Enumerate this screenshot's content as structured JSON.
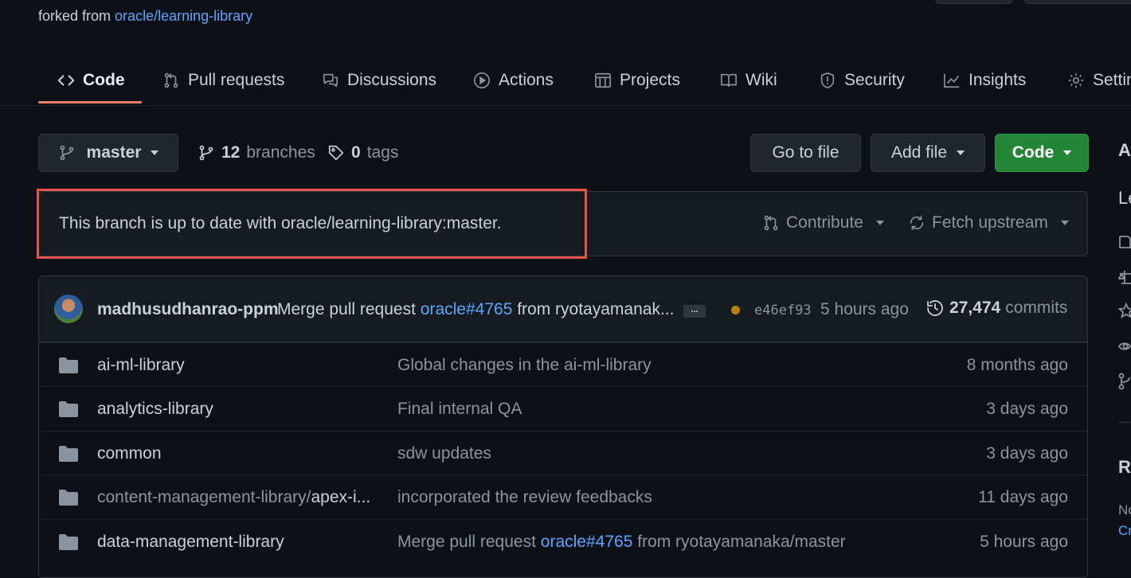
{
  "header": {
    "forked_prefix": "forked from",
    "forked_link": "oracle/learning-library"
  },
  "tabs": [
    {
      "label": "Code",
      "icon": "code-icon",
      "active": true
    },
    {
      "label": "Pull requests",
      "icon": "pull-request-icon"
    },
    {
      "label": "Discussions",
      "icon": "discussions-icon"
    },
    {
      "label": "Actions",
      "icon": "actions-icon"
    },
    {
      "label": "Projects",
      "icon": "projects-icon"
    },
    {
      "label": "Wiki",
      "icon": "book-icon"
    },
    {
      "label": "Security",
      "icon": "shield-icon"
    },
    {
      "label": "Insights",
      "icon": "graph-icon"
    },
    {
      "label": "Settin",
      "icon": "gear-icon"
    }
  ],
  "branch": {
    "name": "master",
    "branches_count": "12",
    "branches_label": "branches",
    "tags_count": "0",
    "tags_label": "tags",
    "go_to_file": "Go to file",
    "add_file": "Add file",
    "code": "Code"
  },
  "status": {
    "message": "This branch is up to date with oracle/learning-library:master.",
    "contribute": "Contribute",
    "fetch_upstream": "Fetch upstream"
  },
  "commit": {
    "author": "madhusudhanrao-ppm",
    "msg_prefix": "Merge pull request",
    "msg_link": "oracle#4765",
    "msg_suffix": "from ryotayamanak...",
    "ellipsis": "...",
    "hash": "e46ef93",
    "time": "5 hours ago",
    "commits_count": "27,474",
    "commits_label": "commits"
  },
  "files": [
    {
      "name": "ai-ml-library",
      "message": "Global changes in the ai-ml-library",
      "age": "8 months ago"
    },
    {
      "name": "analytics-library",
      "message": "Final internal QA",
      "age": "3 days ago"
    },
    {
      "name": "common",
      "message": "sdw updates",
      "age": "3 days ago"
    },
    {
      "name_dim": "content-management-library/",
      "name": "apex-i...",
      "message": "incorporated the review feedbacks",
      "age": "11 days ago"
    },
    {
      "name": "data-management-library",
      "message_prefix": "Merge pull request",
      "message_link": "oracle#4765",
      "message_suffix": "from ryotayamanaka/master",
      "age": "5 hours ago"
    }
  ],
  "sidebar": {
    "about_partial": "A",
    "desc_partial": "Le",
    "releases_partial": "R",
    "no_partial": "No",
    "create_partial": "Cr"
  },
  "colors": {
    "background": "#0d1117",
    "accent_link": "#58a6ff",
    "tab_underline": "#f78166",
    "code_button": "#238636",
    "highlight_box": "#e5534b",
    "commit_status": "#bb8009"
  }
}
